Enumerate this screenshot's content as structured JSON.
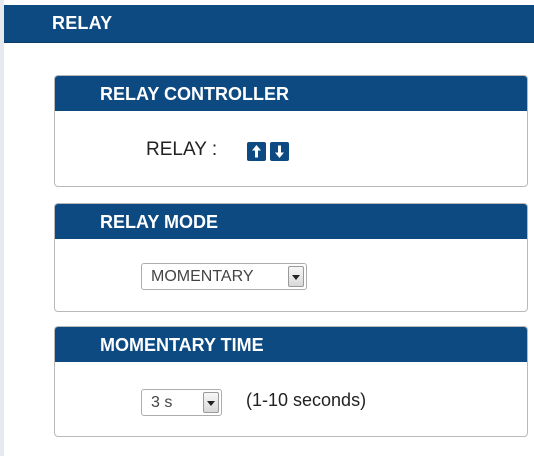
{
  "header": {
    "title": "RELAY"
  },
  "relay_controller": {
    "title": "RELAY CONTROLLER",
    "label": "RELAY :",
    "up_icon": "arrow-up-icon",
    "down_icon": "arrow-down-icon"
  },
  "relay_mode": {
    "title": "RELAY MODE",
    "selected": "MOMENTARY"
  },
  "momentary_time": {
    "title": "MOMENTARY TIME",
    "selected": "3 s",
    "range_note": "(1-10 seconds)"
  },
  "colors": {
    "header_bg": "#0d4a82",
    "header_text": "#ffffff",
    "panel_border": "#b9b9b9"
  }
}
